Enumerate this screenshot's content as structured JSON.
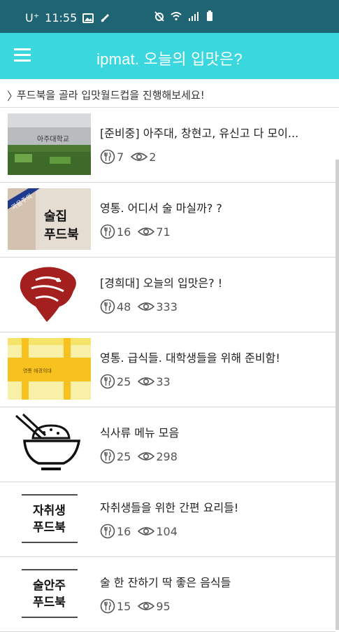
{
  "status": {
    "carrier": "U⁺",
    "time": "11:55"
  },
  "app": {
    "title": "ipmat. 오늘의 입맛은?",
    "hint": "푸드북을 골라 입맛월드컵을 진행해보세요!"
  },
  "foodbooks": [
    {
      "name": "[준비중] 아주대, 창현고, 유신고 다 모이...",
      "likes": "7",
      "views": "2",
      "thumb_text": "아주대학교"
    },
    {
      "name": "영통. 어디서 술 마실까? ?",
      "likes": "16",
      "views": "71",
      "thumb_text": "술집 푸드북",
      "thumb_badge": "과음주의"
    },
    {
      "name": "[경희대] 오늘의 입맛은? !",
      "likes": "48",
      "views": "333"
    },
    {
      "name": "영통. 급식들. 대학생들을 위해 준비함!",
      "likes": "25",
      "views": "33",
      "thumb_text": "영통 애경의대"
    },
    {
      "name": "식사류 메뉴 모음",
      "likes": "25",
      "views": "298"
    },
    {
      "name": "자취생들을 위한 간편 요리들!",
      "likes": "16",
      "views": "104",
      "thumb_text": "자취생 푸드북"
    },
    {
      "name": "술 한 잔하기 딱 좋은 음식들",
      "likes": "15",
      "views": "95",
      "thumb_text": "술안주 푸드북"
    }
  ],
  "icons": {
    "likes": "fork-knife-icon",
    "views": "eye-icon"
  },
  "colors": {
    "status_bar": "#1f6472",
    "app_bar": "#3ad7de",
    "lion_red": "#a3201e",
    "yellow": "#f7c21f"
  }
}
